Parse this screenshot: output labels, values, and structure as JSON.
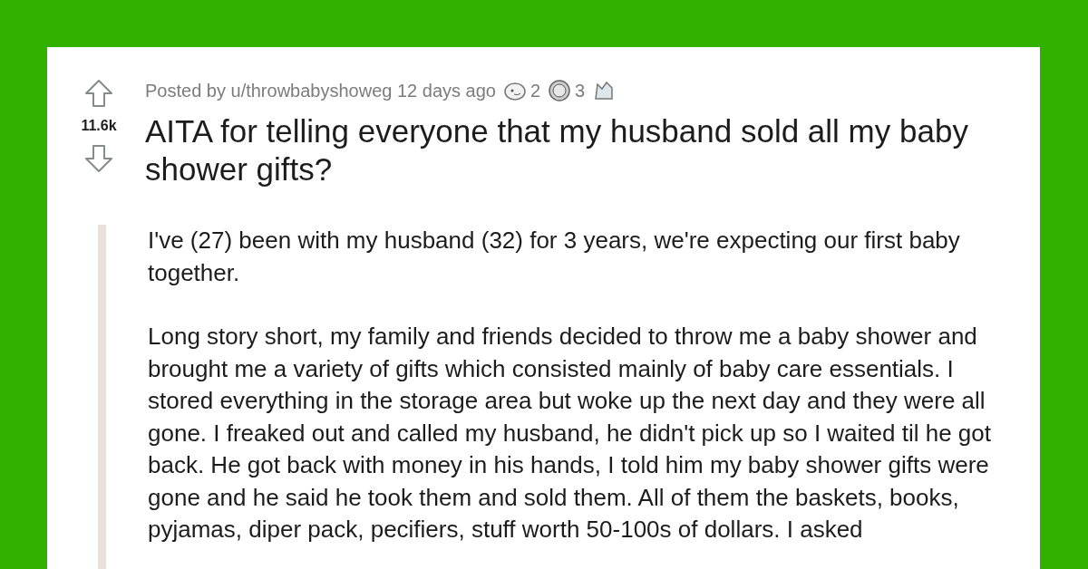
{
  "post": {
    "byline": "Posted by u/throwbabyshoweg 12 days ago",
    "awards": [
      {
        "kind": "face",
        "count": "2"
      },
      {
        "kind": "coin",
        "count": "3"
      },
      {
        "kind": "animal"
      }
    ],
    "score": "11.6k",
    "title": "AITA for telling everyone that my husband sold all my baby shower gifts?",
    "paragraphs": [
      "I've (27) been with my husband (32) for 3 years, we're expecting our first baby together.",
      "Long story short, my family and friends decided to throw me a baby shower and brought me a variety of gifts which consisted mainly of baby care essentials. I stored everything in the storage area but woke up the next day and they were all gone. I freaked out and called my husband, he didn't pick up so I waited til he got back. He got back with money in his hands, I told him my baby shower gifts were gone and he said he took them and sold them. All of them the baskets, books, pyjamas, diper pack, pecifiers, stuff worth 50-100s of dollars. I asked"
    ]
  }
}
